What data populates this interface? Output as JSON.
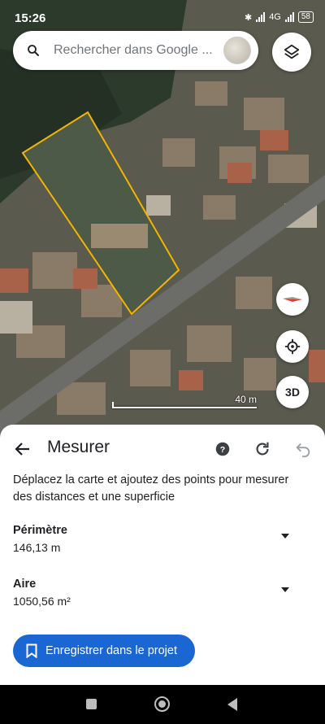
{
  "status_bar": {
    "time": "15:26",
    "network": "4G",
    "battery": "58"
  },
  "search": {
    "placeholder": "Rechercher dans Google ..."
  },
  "map": {
    "scale_label": "40 m",
    "btn_3d": "3D"
  },
  "measure": {
    "title": "Mesurer",
    "description": "Déplacez la carte et ajoutez des points pour mesurer des distances et une superficie",
    "perimeter_label": "Périmètre",
    "perimeter_value": "146,13 m",
    "area_label": "Aire",
    "area_value": "1050,56 m²",
    "save_label": "Enregistrer dans le projet"
  },
  "colors": {
    "accent": "#1a66d2",
    "polygon": "#f4b400"
  }
}
